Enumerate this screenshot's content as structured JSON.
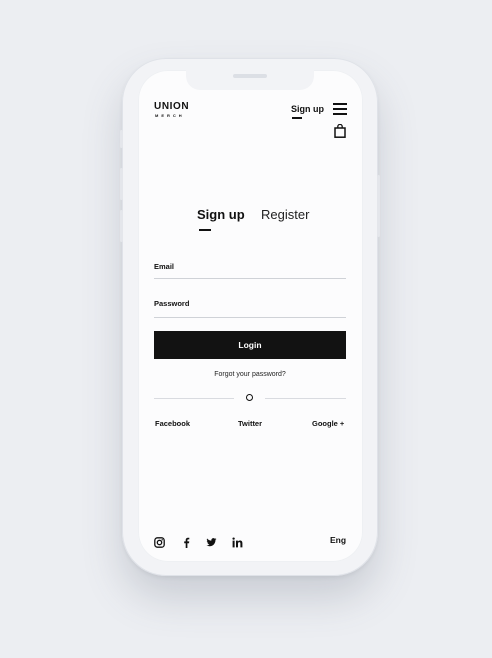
{
  "brand": {
    "name": "UNION",
    "sub": "MERCH"
  },
  "header": {
    "signup_link": "Sign up",
    "menu_icon": "hamburger-icon",
    "cart_icon": "shopping-bag-icon"
  },
  "tabs": {
    "signup": "Sign up",
    "register": "Register",
    "active": "signup"
  },
  "form": {
    "email_label": "Email",
    "email_value": "",
    "password_label": "Password",
    "password_value": "",
    "login_label": "Login",
    "forgot_label": "Forgot your password?",
    "divider_symbol": "o"
  },
  "social_login": {
    "facebook": "Facebook",
    "twitter": "Twitter",
    "google": "Google +"
  },
  "footer": {
    "icons": [
      "instagram-icon",
      "facebook-icon",
      "twitter-icon",
      "linkedin-icon"
    ],
    "language": "Eng"
  },
  "colors": {
    "accent": "#121212",
    "background": "#eceef2",
    "screen": "#fcfcfd"
  }
}
